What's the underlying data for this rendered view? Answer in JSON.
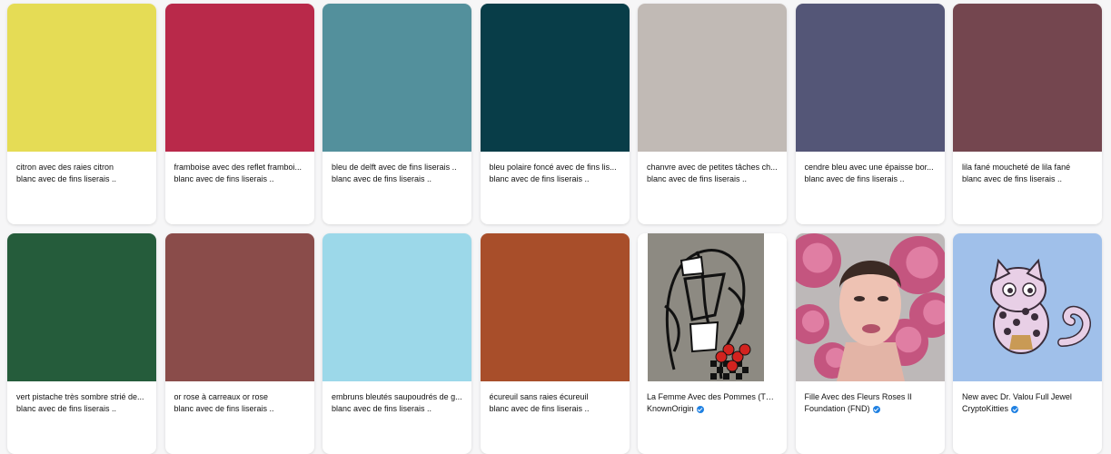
{
  "cards": [
    {
      "color": "#e5dc55",
      "title": "citron avec des raies citron",
      "subtitle": "blanc avec de fins liserais ..",
      "verified": false
    },
    {
      "color": "#b9294a",
      "title": "framboise avec des reflet framboi...",
      "subtitle": "blanc avec de fins liserais ..",
      "verified": false
    },
    {
      "color": "#53909c",
      "title": "bleu de delft avec de fins liserais ..",
      "subtitle": "blanc avec de fins liserais ..",
      "verified": false
    },
    {
      "color": "#083d48",
      "title": "bleu polaire foncé avec de fins lis...",
      "subtitle": "blanc avec de fins liserais ..",
      "verified": false
    },
    {
      "color": "#c1bab5",
      "title": "chanvre avec de petites tâches ch...",
      "subtitle": "blanc avec de fins liserais ..",
      "verified": false
    },
    {
      "color": "#545677",
      "title": "cendre bleu avec une épaisse bor...",
      "subtitle": "blanc avec de fins liserais ..",
      "verified": false
    },
    {
      "color": "#74464f",
      "title": "lila fané moucheté de lila fané",
      "subtitle": "blanc avec de fins liserais ..",
      "verified": false
    },
    {
      "color": "#255c3b",
      "title": "vert pistache très sombre strié de...",
      "subtitle": "blanc avec de fins liserais ..",
      "verified": false
    },
    {
      "color": "#8a4c4a",
      "title": "or rose à carreaux or rose",
      "subtitle": "blanc avec de fins liserais ..",
      "verified": false
    },
    {
      "color": "#9cd8e9",
      "title": "embruns bleutés saupoudrés de g...",
      "subtitle": "blanc avec de fins liserais ..",
      "verified": false
    },
    {
      "color": "#a84e2a",
      "title": "écureuil sans raies écureuil",
      "subtitle": "blanc avec de fins liserais ..",
      "verified": false
    },
    {
      "color": "#8d8a82",
      "image": "picasso-artwork",
      "title": "La Femme Avec des Pommes (The...",
      "subtitle": "KnownOrigin",
      "verified": true
    },
    {
      "color": "#b9b4b4",
      "image": "woman-roses-portrait",
      "title": "Fille Avec des Fleurs Roses II",
      "subtitle": "Foundation (FND)",
      "verified": true
    },
    {
      "color": "#a0c0ea",
      "image": "cryptokitty",
      "title": "New avec Dr. Valou Full Jewel",
      "subtitle": "CryptoKitties",
      "verified": true
    }
  ]
}
